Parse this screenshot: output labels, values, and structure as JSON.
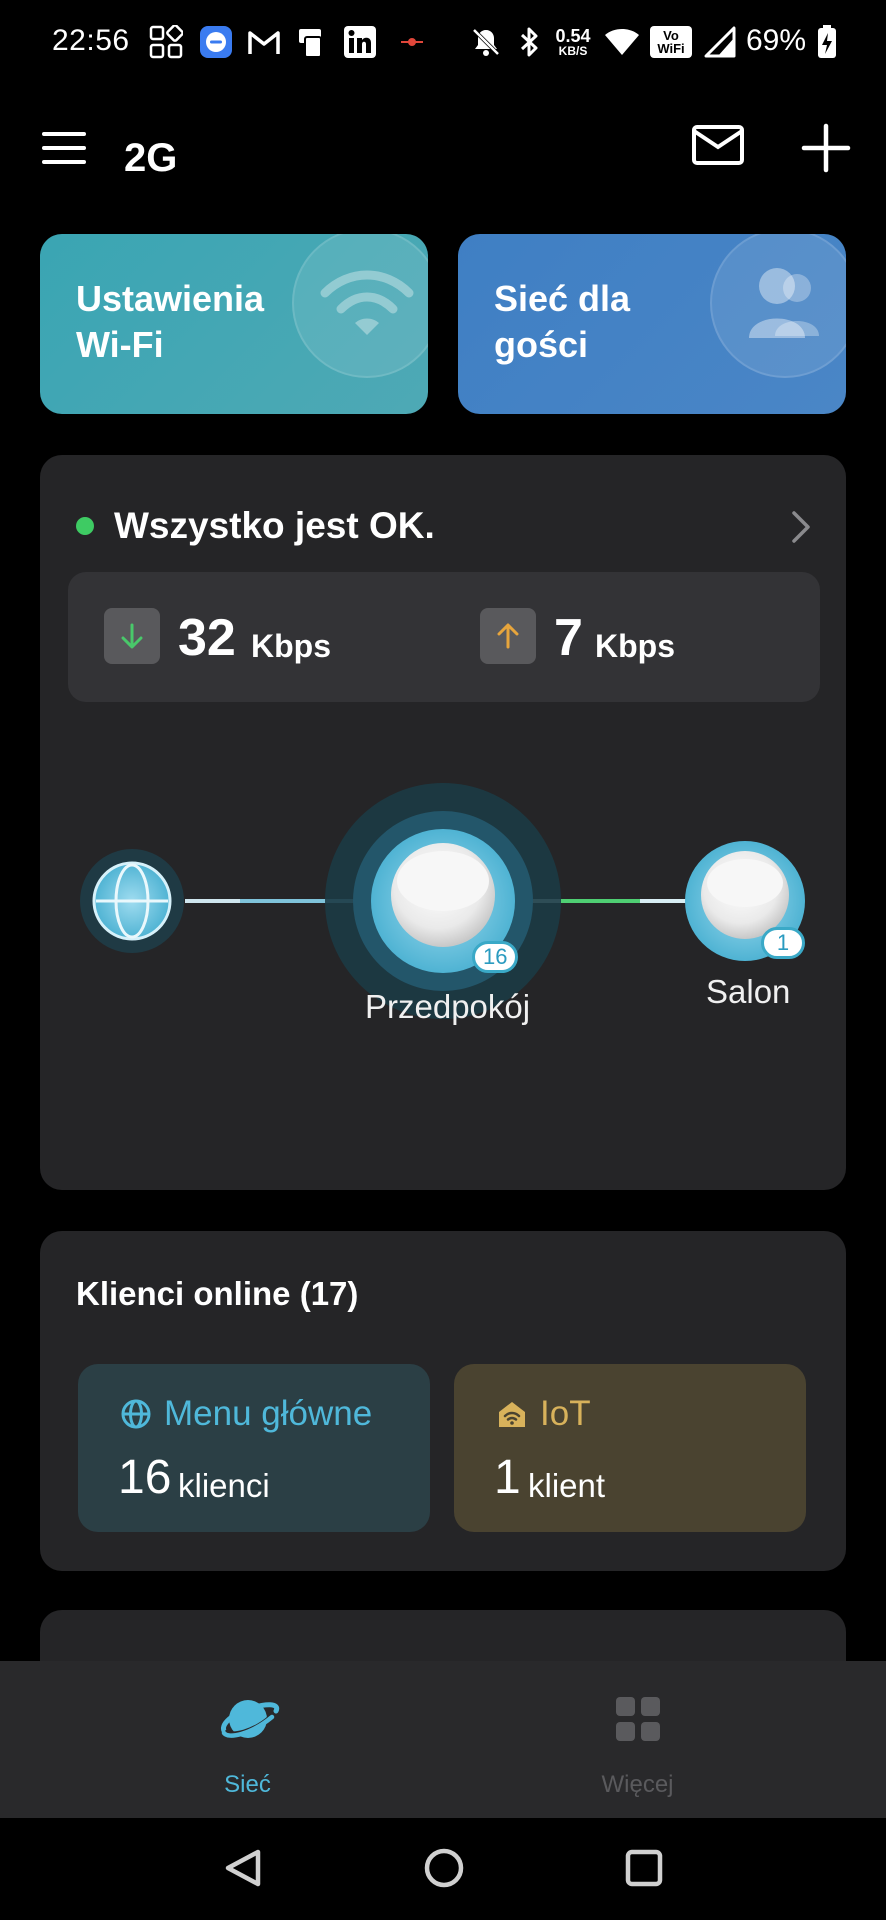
{
  "status_bar": {
    "time": "22:56",
    "net_speed_value": "0.54",
    "net_speed_unit": "KB/S",
    "volte_top": "Vo",
    "volte_bottom": "WiFi",
    "battery": "69%"
  },
  "header": {
    "title": "2G"
  },
  "tiles": {
    "wifi_line1": "Ustawienia",
    "wifi_line2": "Wi-Fi",
    "guest_line1": "Sieć dla",
    "guest_line2": "gości"
  },
  "status_card": {
    "status_text": "Wszystko jest OK.",
    "download_value": "32",
    "download_unit": "Kbps",
    "upload_value": "7",
    "upload_unit": "Kbps",
    "main_node_label": "Przedpokój",
    "main_node_clients": "16",
    "satellite_label": "Salon",
    "satellite_clients": "1"
  },
  "clients": {
    "title": "Klienci online (17)",
    "main_name": "Menu główne",
    "main_count": "16",
    "main_unit": "klienci",
    "iot_name": "IoT",
    "iot_count": "1",
    "iot_unit": "klient"
  },
  "bottom_nav": {
    "network_label": "Sieć",
    "more_label": "Więcej"
  },
  "colors": {
    "accent": "#4fb8da",
    "ok": "#3ecb63",
    "iot": "#d8b25b"
  }
}
